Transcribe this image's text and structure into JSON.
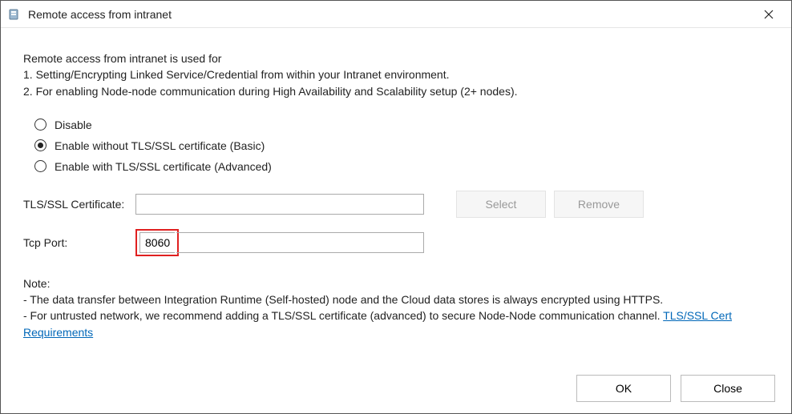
{
  "title": "Remote access from intranet",
  "intro": {
    "lead": "Remote access from intranet is used for",
    "line1": "1. Setting/Encrypting Linked Service/Credential from within your Intranet environment.",
    "line2": "2. For enabling Node-node communication during High Availability and Scalability setup (2+ nodes)."
  },
  "radios": {
    "disable": "Disable",
    "basic": "Enable without TLS/SSL certificate (Basic)",
    "advanced": "Enable with TLS/SSL certificate (Advanced)",
    "selected": "basic"
  },
  "cert": {
    "label": "TLS/SSL Certificate:",
    "value": "",
    "select_btn": "Select",
    "remove_btn": "Remove"
  },
  "port": {
    "label": "Tcp Port:",
    "value": "8060"
  },
  "note": {
    "heading": "Note:",
    "line1": " - The data transfer between Integration Runtime (Self-hosted) node and the Cloud data stores is always encrypted using HTTPS.",
    "line2_a": " - For untrusted network, we recommend adding a TLS/SSL certificate (advanced) to secure Node-Node communication channel. ",
    "link": "TLS/SSL Cert Requirements"
  },
  "footer": {
    "ok": "OK",
    "close": "Close"
  }
}
